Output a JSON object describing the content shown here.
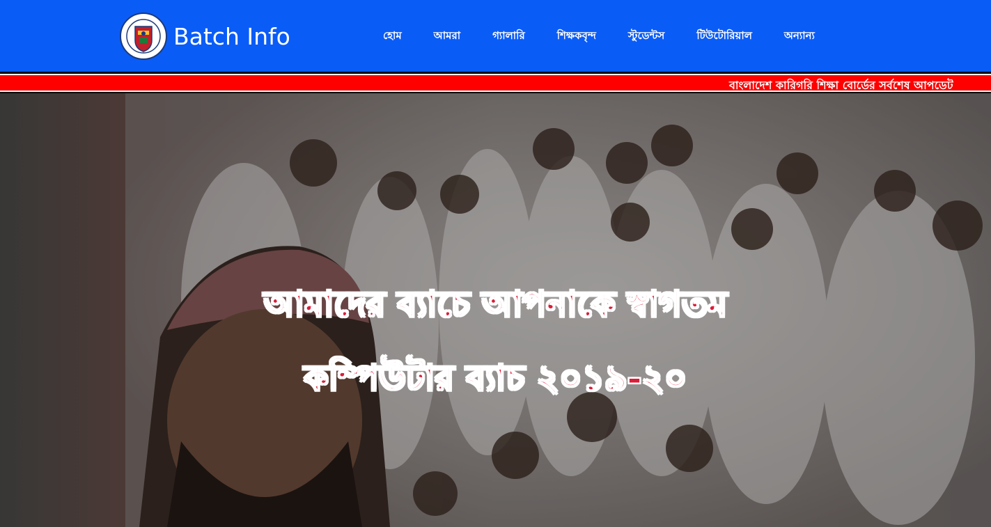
{
  "brand": {
    "name": "Batch Info",
    "logo_icon": "institute-crest-icon"
  },
  "nav": {
    "items": [
      {
        "label": "হোম"
      },
      {
        "label": "আমরা"
      },
      {
        "label": "গ্যালারি"
      },
      {
        "label": "শিক্ষকবৃন্দ"
      },
      {
        "label": "স্টুডেন্টস"
      },
      {
        "label": "টিউটোরিয়াল"
      },
      {
        "label": "অন্যান্য"
      }
    ]
  },
  "ticker": {
    "text": "বাংলাদেশ কারিগরি শিক্ষা বোর্ডের সর্বশেষ আপডেট"
  },
  "hero": {
    "line1": "আমাদের ব্যাচে আপনাকে স্বাগতম",
    "line2": "কম্পিউটার ব্যাচ ২০১৯-২০"
  },
  "colors": {
    "navbar": "#0a5cf7",
    "ticker": "#ff0000",
    "hero_text": "#dc1c39"
  }
}
